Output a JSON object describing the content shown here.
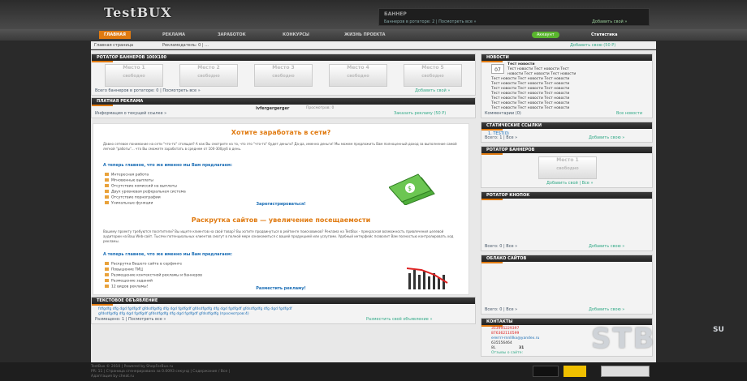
{
  "logo": "TestBUX",
  "banner": {
    "title": "БАННЕР",
    "left": "Баннеров в ротаторе: 2 | Посмотреть все »",
    "right": "Добавить свой »"
  },
  "nav": {
    "items": [
      "ГЛАВНАЯ",
      "РЕКЛАМА",
      "ЗАРАБОТОК",
      "КОНКУРСЫ",
      "ЖИЗНЬ ПРОЕКТА"
    ],
    "account": "Аккаунт",
    "stats": "Статистика"
  },
  "crumb": {
    "left": "Главная страница",
    "mid": "Рекламодатель: 0 | ...",
    "right": "Добавить свою (50 Р)"
  },
  "rotator": {
    "title": "РОТАТОР БАННЕРОВ 100Х100",
    "slots": [
      "Место 1",
      "Место 2",
      "Место 3",
      "Место 4",
      "Место 5"
    ],
    "sub": "свободно",
    "left": "Всего баннеров в ротаторе: 0 | Посмотреть все »",
    "right": "Добавить свой »"
  },
  "paid": {
    "title": "ПЛАТНАЯ РЕКЛАМА",
    "text": "ivfergergerger",
    "views": "Просмотров: 0",
    "left": "Информация о текущей ссылке »",
    "right": "Заказать рекламу (50 Р)"
  },
  "content": {
    "h1": "Хотите заработать в сети?",
    "p1": "Давно сетевое понимание на сети \"что-то\" стоящая? А как Вы смотрите на то, что это \"что-то\" будет деньги? Да-да, именно деньги! Мы можем предложить Вам полноценный доход за выполнение самой легкой \"работы\"... что Вы сможете заработать в среднем от 100-300руб в день.",
    "q1": "А теперь главное, что же именно мы Вам предлагаем:",
    "l1": [
      "Интересная работа",
      "Мгновенные выплаты",
      "Отсутствие комиссий на выплаты",
      "Двух уровневая реферальная система",
      "Отсутствие порнографии",
      "Уникальные функции"
    ],
    "reg": "Зарегистрироваться!",
    "h2": "Раскрутка сайтов — увеличение посещаемости",
    "p2": "Вашему проекту требуются посетители? Вы ищете клиентов на свой товар? Вы хотите продвинуться в рейтинге поисковиков? Реклама на TestBux - прекрасная возможность привлечения целевой аудитории на Ваш Web-сайт. Тысячи потенциальных клиентов смогут в полной мере ознакомиться с вашей продукцией или услугами. Удобный интерфейс позволит Вам полностью контролировать ход рекламы.",
    "q2": "А теперь главное, что же именно мы Вам предлагаем:",
    "l2": [
      "Раскрутка Вашего сайта в серфинге",
      "Повышение ТИЦ",
      "Размещение контекстной рекламы и баннеров",
      "Размещение заданий",
      "12 видов рекламы!"
    ],
    "place": "Разместить рекламу!"
  },
  "textad": {
    "title": "ТЕКСТОВОЕ ОБЪЯВЛЕНИЕ",
    "l1": "fdfgdfg dfg dgd fgdfgdf gfdsdfgdfg dfg dgd fgdfgdf gfdsdfgdfg dfg dgd fgdfgdf gfdsdfgdfg dfg dgd fgdfgdf",
    "l2": "gfdsdfgdfg dfg dgd fgdfgdf gfdsdfgdfg dfg dgd fgdfgdf gfdsdfgdfg (просмотров:4)",
    "left": "Размещено: 1 | Посмотреть все »",
    "right": "Разместить своё объявление »"
  },
  "news": {
    "title": "НОВОСТИ",
    "date": "07",
    "l1": "Тест новости",
    "lines": [
      "Тест новости Тест новости Тест",
      "новости Тест новости Тест новости",
      "Тест новости Тест новости Тест новости",
      "Тест новости Тест новости Тест новости",
      "Тест новости Тест новости Тест новости",
      "Тест новости Тест новости Тест новости",
      "Тест новости Тест новости Тест новости",
      "Тест новости Тест новости Тест новости",
      "Тест новости Тест новости Тест новости",
      "Тест новости Тест новости Тест новости"
    ],
    "left": "Комментарии (0)",
    "right": "Все новости"
  },
  "static": {
    "title": "СТАТИЧЕСКИЕ ССЫЛКИ",
    "item": "1. TEST(0)",
    "left": "Всего: 1 | Все »",
    "right": "Добавить свою »"
  },
  "rotb": {
    "title": "РОТАТОР БАННЕРОВ",
    "slot": "Место 1",
    "sub": "свободно",
    "right": "Добавить свой | Все »"
  },
  "rotk": {
    "title": "РОТАТОР КНОПОК",
    "left": "Всего: 0 | Все »",
    "right": "Добавить свою »"
  },
  "cloud": {
    "title": "ОБЛАКО САЙТОВ",
    "left": "Всего: 0 | Все »",
    "right": "Добавить свою »"
  },
  "contacts": {
    "title": "КОНТАКТЫ",
    "items": [
      "353995229397",
      "876362110599",
      "ererrrr-rnnlllkx@yandex.ru",
      "635556464",
      "8L"
    ],
    "n31": "31",
    "bottom": "Отзывы о сайте:"
  },
  "footer": {
    "l1": "TestBux © 2010 | Powered by ShopForBux.ru",
    "l2": "PR: 11 | Страница сгенерирована за 0.0093 секунд | Содержание / Все |",
    "l3": "Адаптация by cheat.ru"
  },
  "watermark": "STB",
  "watermark_su": "SU"
}
